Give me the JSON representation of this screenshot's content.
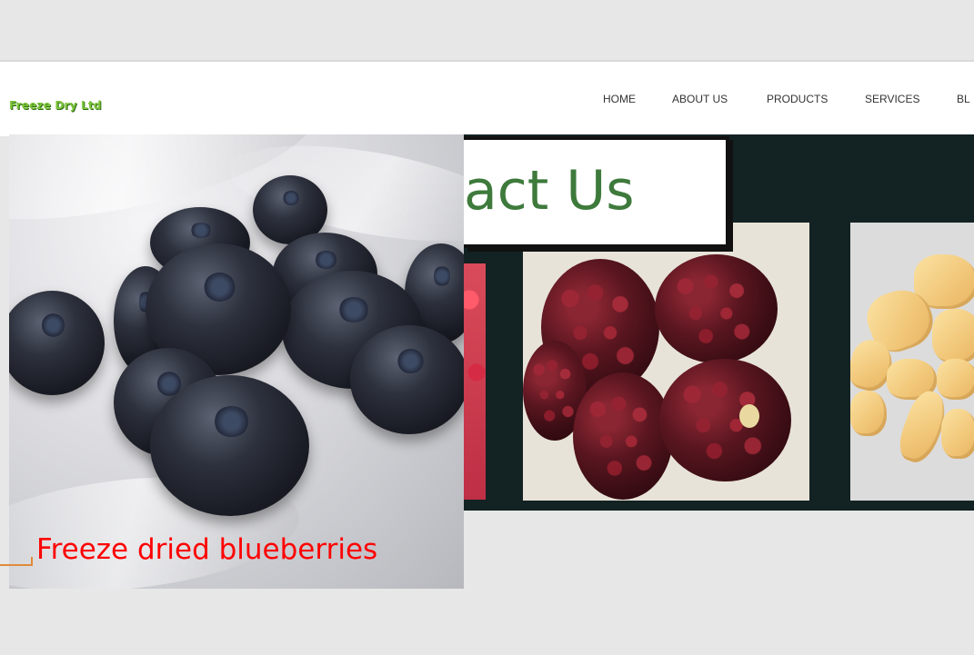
{
  "site": {
    "logo": "Freeze Dry Ltd"
  },
  "nav": {
    "items": [
      {
        "label": "HOME"
      },
      {
        "label": "ABOUT US"
      },
      {
        "label": "PRODUCTS"
      },
      {
        "label": "SERVICES"
      },
      {
        "label": "BL"
      }
    ]
  },
  "hero": {
    "heading_fragment": "act Us"
  },
  "photo": {
    "caption": "Freeze dried blueberries"
  },
  "colors": {
    "logo": "#7cc53a",
    "heading": "#3e7a3c",
    "caption": "#ff0000",
    "panel": "#132222"
  }
}
